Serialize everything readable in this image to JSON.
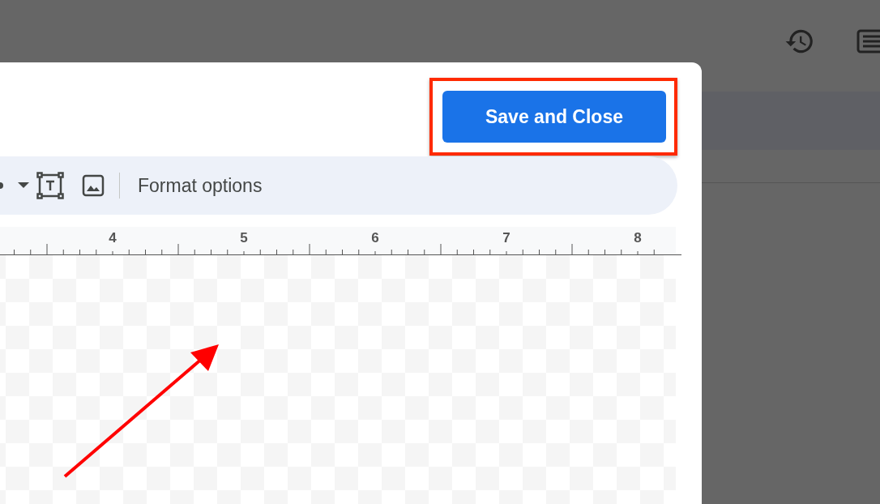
{
  "dialog": {
    "save_button": "Save and Close",
    "highlighted": true
  },
  "toolbar": {
    "format_options": "Format options"
  },
  "ruler": {
    "labels": [
      "4",
      "5",
      "6",
      "7",
      "8"
    ]
  },
  "canvas": {
    "kind": "checkerboard"
  }
}
